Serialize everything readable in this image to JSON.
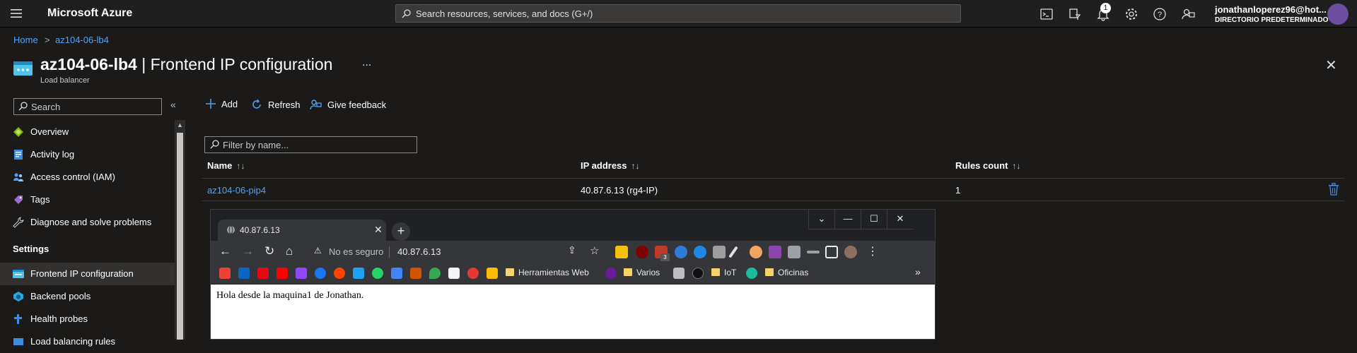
{
  "topbar": {
    "brand": "Microsoft Azure",
    "search_placeholder": "Search resources, services, and docs (G+/)",
    "notifications_count": "1",
    "user_name": "jonathanloperez96@hot...",
    "user_directory": "DIRECTORIO PREDETERMINADO ..."
  },
  "breadcrumb": {
    "home": "Home",
    "separator": ">",
    "resource": "az104-06-lb4"
  },
  "header": {
    "resource_name": "az104-06-lb4",
    "separator": " | ",
    "section": "Frontend IP configuration",
    "subtitle": "Load balancer",
    "more": "...",
    "close": "✕"
  },
  "sidebar": {
    "search_placeholder": "Search",
    "collapse": "«",
    "items": [
      {
        "label": "Overview",
        "color": "#7fba00"
      },
      {
        "label": "Activity log",
        "color": "#3c8de2"
      },
      {
        "label": "Access control (IAM)",
        "color": "#4fa3f7"
      },
      {
        "label": "Tags",
        "color": "#9b6bd6"
      },
      {
        "label": "Diagnose and solve problems",
        "color": "#c8c8c8"
      }
    ],
    "settings_header": "Settings",
    "settings_items": [
      {
        "label": "Frontend IP configuration",
        "color": "#4fc3e8"
      },
      {
        "label": "Backend pools",
        "color": "#2aa6dd"
      },
      {
        "label": "Health probes",
        "color": "#3c8de2"
      },
      {
        "label": "Load balancing rules",
        "color": "#3c8de2"
      }
    ]
  },
  "commandbar": {
    "add": "Add",
    "refresh": "Refresh",
    "feedback": "Give feedback"
  },
  "filter_placeholder": "Filter by name...",
  "table": {
    "headers": [
      "Name",
      "IP address",
      "Rules count"
    ],
    "sort_icon": "↑↓",
    "rows": [
      {
        "name": "az104-06-pip4",
        "ip": "40.87.6.13 (rg4-IP)",
        "rules": "1"
      }
    ]
  },
  "browser": {
    "tab_title": "40.87.6.13",
    "tab_close": "✕",
    "new_tab": "+",
    "security_label": "No es seguro",
    "url": "40.87.6.13",
    "extension_badge": "3",
    "bookmarks": [
      "Herramientas Web",
      "Varios",
      "IoT",
      "Oficinas"
    ],
    "bookmarks_more": "»",
    "page_text": "Hola desde la maquina1 de Jonathan."
  },
  "colors": {
    "accent_link": "#4fa3f7",
    "topbar_bg": "#1f1f1f",
    "page_bg": "#1b1a19",
    "delete_icon": "#3c8de2"
  }
}
